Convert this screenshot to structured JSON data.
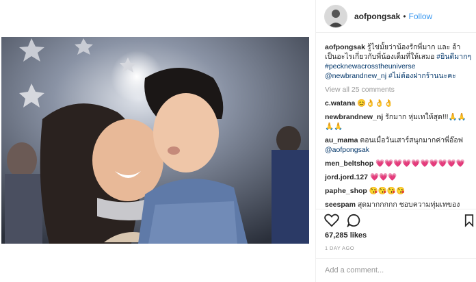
{
  "post": {
    "username": "aofpongsak",
    "separator": "•",
    "follow_label": "Follow"
  },
  "caption": {
    "username": "aofpongsak",
    "text": "รู้ไข่มั้ยว่าน้องรักพี่มาก และ อ้าเป็นอะไรเกี่ยวกับพี่น้องเต็มที่ให้เสมอ",
    "hashtag1": "#ยินดีมากๆ",
    "hashtag2": "#pecknewacrosstheuniverse",
    "mention": "@newbrandnew_nj",
    "hashtag3": "#ไม่ต้องฝากร้านนะคะ"
  },
  "view_all": "View all 25 comments",
  "comments": [
    {
      "user": "c.watana",
      "text": "😊👌👌👌"
    },
    {
      "user": "newbrandnew_nj",
      "text": "รักมาก หุ่มเทให้สุด!!!🙏🙏🙏🙏"
    },
    {
      "user": "au_mama",
      "text": "ตอนเมื่อวันเสาร์สนุกมากค่าพี่อ๊อฟ",
      "mention": "@aofpongsak"
    },
    {
      "user": "men_beltshop",
      "text": "💗💗💗💗💗💗💗💗💗💗"
    },
    {
      "user": "jord.jord.127",
      "text": "💗💗💗"
    },
    {
      "user": "paphe_shop",
      "text": "😘😘😘😘"
    },
    {
      "user": "seespam",
      "text": "สุดมากกกกก ชอบความทุ่มเทของ"
    }
  ],
  "likes": "67,285 likes",
  "date": "1 DAY AGO",
  "add_comment_placeholder": "Add a comment...",
  "icons": {
    "like": "heart-icon",
    "comment": "comment-bubble-icon",
    "save": "bookmark-icon"
  },
  "colors": {
    "follow": "#3897f0",
    "link": "#003569",
    "muted": "#999999"
  }
}
